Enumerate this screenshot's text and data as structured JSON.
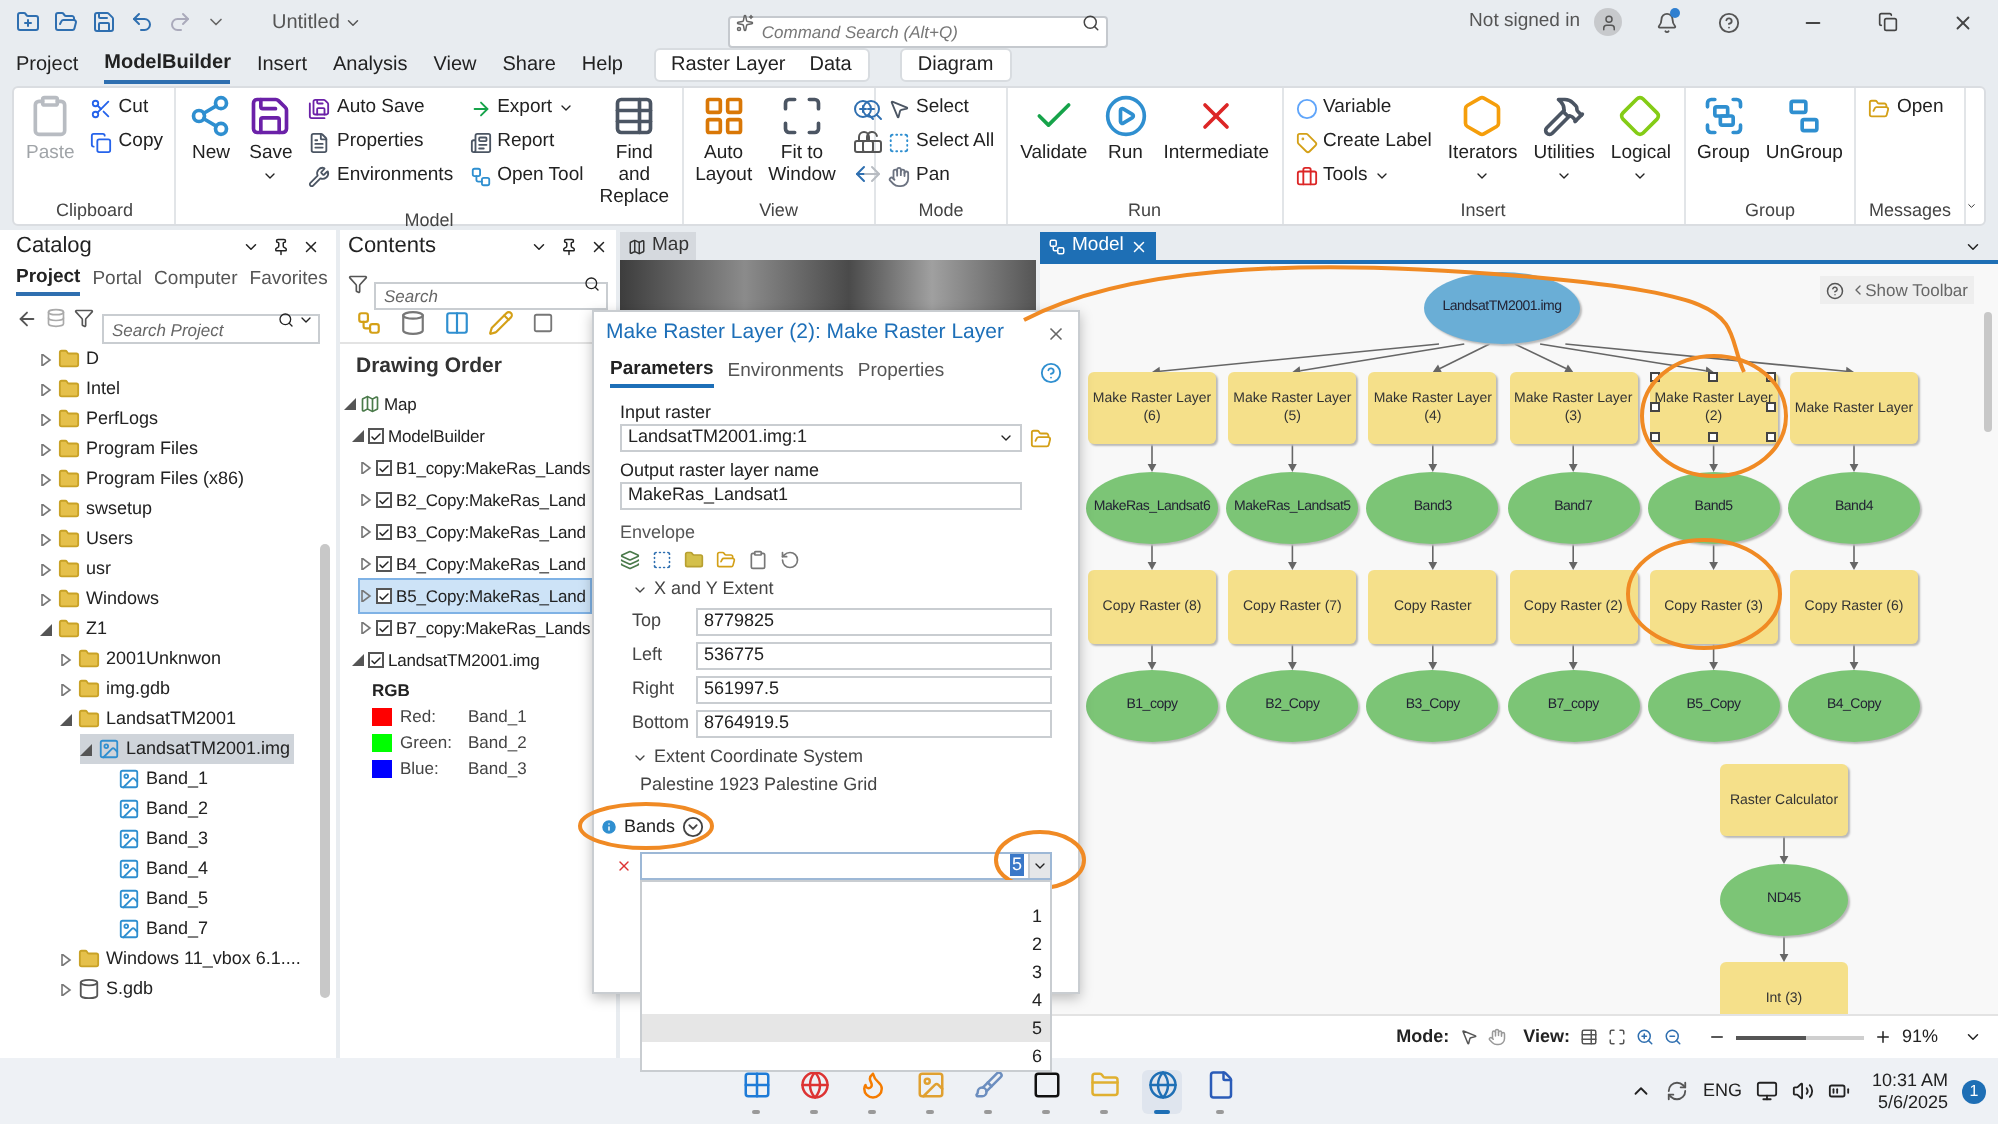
{
  "titlebar": {
    "document": "Untitled",
    "search_placeholder": "Command Search (Alt+Q)",
    "account": "Not signed in"
  },
  "menu_tabs": [
    {
      "label": "Project",
      "selected": false
    },
    {
      "label": "ModelBuilder",
      "selected": true
    },
    {
      "label": "Insert",
      "selected": false
    },
    {
      "label": "Analysis",
      "selected": false
    },
    {
      "label": "View",
      "selected": false
    },
    {
      "label": "Share",
      "selected": false
    },
    {
      "label": "Help",
      "selected": false
    }
  ],
  "context_groups": [
    {
      "tabs": [
        {
          "label": "Raster Layer",
          "selected": false
        },
        {
          "label": "Data",
          "selected": false
        }
      ]
    },
    {
      "tabs": [
        {
          "label": "Diagram",
          "selected": false
        }
      ]
    }
  ],
  "ribbon": [
    {
      "name": "Clipboard",
      "columns": [
        {
          "kind": "large",
          "label": "Paste",
          "menu": false,
          "disabled": true
        },
        {
          "kind": "stack",
          "items": [
            {
              "label": "Cut",
              "menu": false,
              "disabled": false
            },
            {
              "label": "Copy",
              "menu": false,
              "disabled": false
            }
          ]
        }
      ]
    },
    {
      "name": "Model",
      "columns": [
        {
          "kind": "large",
          "label": "New",
          "menu": false,
          "disabled": false
        },
        {
          "kind": "large",
          "label": "Save",
          "menu": true,
          "disabled": false
        },
        {
          "kind": "stack",
          "items": [
            {
              "label": "Auto Save",
              "menu": false,
              "disabled": false
            },
            {
              "label": "Properties",
              "menu": false,
              "disabled": false
            },
            {
              "label": "Environments",
              "menu": false,
              "disabled": false
            }
          ]
        },
        {
          "kind": "stack",
          "items": [
            {
              "label": "Export",
              "menu": true,
              "disabled": false
            },
            {
              "label": "Report",
              "menu": false,
              "disabled": false
            },
            {
              "label": "Open Tool",
              "menu": false,
              "disabled": false
            }
          ]
        },
        {
          "kind": "large",
          "label": "Find and Replace",
          "menu": false,
          "disabled": false
        }
      ]
    },
    {
      "name": "View",
      "columns": [
        {
          "kind": "large",
          "label": "Auto Layout",
          "menu": false,
          "disabled": false
        },
        {
          "kind": "large",
          "label": "Fit to Window",
          "menu": false,
          "disabled": false
        },
        {
          "kind": "tools"
        }
      ]
    },
    {
      "name": "Mode",
      "columns": [
        {
          "kind": "stack",
          "items": [
            {
              "label": "Select",
              "menu": false,
              "disabled": false
            },
            {
              "label": "Select All",
              "menu": false,
              "disabled": false
            },
            {
              "label": "Pan",
              "menu": false,
              "disabled": false
            }
          ]
        }
      ]
    },
    {
      "name": "Run",
      "columns": [
        {
          "kind": "large",
          "label": "Validate",
          "menu": false,
          "disabled": false
        },
        {
          "kind": "large",
          "label": "Run",
          "menu": false,
          "disabled": false
        },
        {
          "kind": "large",
          "label": "Intermediate",
          "menu": false,
          "disabled": false
        }
      ]
    },
    {
      "name": "Insert",
      "columns": [
        {
          "kind": "stack",
          "items": [
            {
              "label": "Variable",
              "menu": false,
              "disabled": false
            },
            {
              "label": "Create Label",
              "menu": false,
              "disabled": false
            },
            {
              "label": "Tools",
              "menu": true,
              "disabled": false
            }
          ]
        },
        {
          "kind": "large",
          "label": "Iterators",
          "menu": true,
          "disabled": false
        },
        {
          "kind": "large",
          "label": "Utilities",
          "menu": true,
          "disabled": false
        },
        {
          "kind": "large",
          "label": "Logical",
          "menu": true,
          "disabled": false
        }
      ]
    },
    {
      "name": "Group",
      "columns": [
        {
          "kind": "large",
          "label": "Group",
          "menu": false,
          "disabled": false
        },
        {
          "kind": "large",
          "label": "UnGroup",
          "menu": false,
          "disabled": false
        }
      ]
    },
    {
      "name": "Messages",
      "columns": [
        {
          "kind": "stack",
          "items": [
            {
              "label": "Open",
              "menu": false,
              "disabled": false
            }
          ]
        }
      ]
    }
  ],
  "catalog": {
    "title": "Catalog",
    "tabs": [
      {
        "label": "Project",
        "selected": true
      },
      {
        "label": "Portal",
        "selected": false
      },
      {
        "label": "Computer",
        "selected": false
      },
      {
        "label": "Favorites",
        "selected": false
      }
    ],
    "search_placeholder": "Search Project",
    "tree": [
      {
        "label": "D",
        "kind": "folder",
        "expanded": false,
        "selected": false
      },
      {
        "label": "Intel",
        "kind": "folder",
        "expanded": false,
        "selected": false
      },
      {
        "label": "PerfLogs",
        "kind": "folder",
        "expanded": false,
        "selected": false
      },
      {
        "label": "Program Files",
        "kind": "folder",
        "expanded": false,
        "selected": false
      },
      {
        "label": "Program Files (x86)",
        "kind": "folder",
        "expanded": false,
        "selected": false
      },
      {
        "label": "swsetup",
        "kind": "folder",
        "expanded": false,
        "selected": false
      },
      {
        "label": "Users",
        "kind": "folder",
        "expanded": false,
        "selected": false
      },
      {
        "label": "usr",
        "kind": "folder",
        "expanded": false,
        "selected": false
      },
      {
        "label": "Windows",
        "kind": "folder",
        "expanded": false,
        "selected": false
      },
      {
        "label": "Z1",
        "kind": "folder",
        "expanded": true,
        "selected": false,
        "children": [
          {
            "label": "2001Unknwon",
            "kind": "folder",
            "expanded": false,
            "selected": false
          },
          {
            "label": "img.gdb",
            "kind": "folder",
            "expanded": false,
            "selected": false
          },
          {
            "label": "LandsatTM2001",
            "kind": "folder",
            "expanded": true,
            "selected": false,
            "children": [
              {
                "label": "LandsatTM2001.img",
                "kind": "raster",
                "expanded": true,
                "selected": true,
                "children": [
                  {
                    "label": "Band_1",
                    "kind": "band",
                    "selected": false
                  },
                  {
                    "label": "Band_2",
                    "kind": "band",
                    "selected": false
                  },
                  {
                    "label": "Band_3",
                    "kind": "band",
                    "selected": false
                  },
                  {
                    "label": "Band_4",
                    "kind": "band",
                    "selected": false
                  },
                  {
                    "label": "Band_5",
                    "kind": "band",
                    "selected": false
                  },
                  {
                    "label": "Band_7",
                    "kind": "band",
                    "selected": false
                  }
                ]
              }
            ]
          },
          {
            "label": "Windows 11_vbox 6.1....",
            "kind": "folder",
            "expanded": false,
            "selected": false
          },
          {
            "label": "S.gdb",
            "kind": "gdb",
            "expanded": false,
            "selected": false
          }
        ]
      }
    ]
  },
  "contents": {
    "title": "Contents",
    "search_placeholder": "Search",
    "heading": "Drawing Order",
    "tree": [
      {
        "label": "Map",
        "expanded": true,
        "selected": false,
        "children": [
          {
            "label": "ModelBuilder",
            "checked": true,
            "expanded": true,
            "selected": false,
            "children": [
              {
                "label": "B1_copy:MakeRas_Lands",
                "checked": true,
                "expanded": false,
                "selected": false
              },
              {
                "label": "B2_Copy:MakeRas_Land",
                "checked": true,
                "expanded": false,
                "selected": false
              },
              {
                "label": "B3_Copy:MakeRas_Land",
                "checked": true,
                "expanded": false,
                "selected": false
              },
              {
                "label": "B4_Copy:MakeRas_Land",
                "checked": true,
                "expanded": false,
                "selected": false
              },
              {
                "label": "B5_Copy:MakeRas_Land",
                "checked": true,
                "expanded": false,
                "selected": true
              },
              {
                "label": "B7_copy:MakeRas_Lands",
                "checked": true,
                "expanded": false,
                "selected": false
              }
            ]
          },
          {
            "label": "LandsatTM2001.img",
            "checked": true,
            "expanded": true,
            "selected": false,
            "legend": {
              "title": "RGB",
              "items": [
                {
                  "channel": "Red:",
                  "band": "Band_1",
                  "color": "#ff0000"
                },
                {
                  "channel": "Green:",
                  "band": "Band_2",
                  "color": "#00ff00"
                },
                {
                  "channel": "Blue:",
                  "band": "Band_3",
                  "color": "#0000ff"
                }
              ]
            }
          }
        ]
      }
    ]
  },
  "dialog": {
    "title": "Make Raster Layer (2): Make Raster Layer",
    "tabs": [
      {
        "label": "Parameters",
        "selected": true
      },
      {
        "label": "Environments",
        "selected": false
      },
      {
        "label": "Properties",
        "selected": false
      }
    ],
    "input_raster": {
      "label": "Input raster",
      "value": "LandsatTM2001.img:1"
    },
    "output_name": {
      "label": "Output raster layer name",
      "value": "MakeRas_Landsat1"
    },
    "envelope": {
      "label": "Envelope",
      "extent_heading": "X and Y Extent",
      "extent_expanded": true,
      "fields": [
        {
          "label": "Top",
          "value": "8779825"
        },
        {
          "label": "Left",
          "value": "536775"
        },
        {
          "label": "Right",
          "value": "561997.5"
        },
        {
          "label": "Bottom",
          "value": "8764919.5"
        }
      ],
      "coord_heading": "Extent Coordinate System",
      "coord_expanded": true,
      "coord_value": "Palestine 1923 Palestine Grid"
    },
    "bands": {
      "label": "Bands",
      "value": "5",
      "options": [
        {
          "label": "1",
          "selected": false
        },
        {
          "label": "2",
          "selected": false
        },
        {
          "label": "3",
          "selected": false
        },
        {
          "label": "4",
          "selected": false
        },
        {
          "label": "5",
          "selected": true
        },
        {
          "label": "6",
          "selected": false
        }
      ]
    }
  },
  "map_tab": {
    "label": "Map",
    "selected": false
  },
  "model": {
    "tab": {
      "label": "Model",
      "selected": true
    },
    "show_toolbar": "Show Toolbar",
    "source": "LandsatTM2001.img",
    "chains": [
      {
        "tool": "Make Raster Layer (6)",
        "selected": false,
        "output": "MakeRas_Landsat6",
        "copy_tool": "Copy Raster (8)",
        "copy_output": "B1_copy"
      },
      {
        "tool": "Make Raster Layer (5)",
        "selected": false,
        "output": "MakeRas_Landsat5",
        "copy_tool": "Copy Raster (7)",
        "copy_output": "B2_Copy"
      },
      {
        "tool": "Make Raster Layer (4)",
        "selected": false,
        "output": "Band3",
        "copy_tool": "Copy Raster",
        "copy_output": "B3_Copy"
      },
      {
        "tool": "Make Raster Layer (3)",
        "selected": false,
        "output": "Band7",
        "copy_tool": "Copy Raster (2)",
        "copy_output": "B7_copy"
      },
      {
        "tool": "Make Raster Layer (2)",
        "selected": true,
        "output": "Band5",
        "copy_tool": "Copy Raster (3)",
        "copy_output": "B5_Copy"
      },
      {
        "tool": "Make Raster Layer",
        "selected": false,
        "output": "Band4",
        "copy_tool": "Copy Raster (6)",
        "copy_output": "B4_Copy"
      }
    ],
    "calc": {
      "tool": "Raster Calculator",
      "output": "ND45",
      "next_tool": "Int (3)"
    },
    "status": {
      "mode_label": "Mode:",
      "view_label": "View:",
      "zoom": {
        "level": 0.55,
        "reading": "91%"
      }
    }
  },
  "taskbar": {
    "apps": [
      {
        "active": false
      },
      {
        "active": false
      },
      {
        "active": false
      },
      {
        "active": false
      },
      {
        "active": false
      },
      {
        "active": false
      },
      {
        "active": false
      },
      {
        "active": true
      },
      {
        "active": false
      }
    ],
    "language": "ENG",
    "time": "10:31 AM",
    "date": "5/6/2025",
    "badge": "1"
  }
}
